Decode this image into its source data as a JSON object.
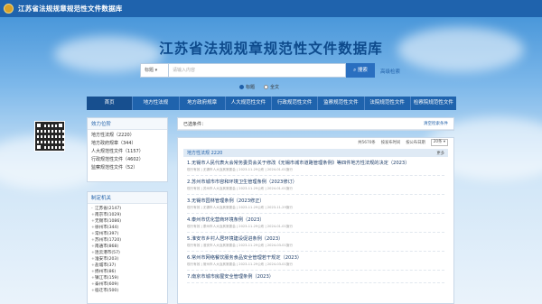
{
  "header": {
    "site_title": "江苏省法规规章规范性文件数据库",
    "links": [
      "",
      ""
    ]
  },
  "main_title": "江苏省法规规章规范性文件数据库",
  "search": {
    "scope_value": "标题",
    "placeholder": "请输入内容",
    "button_label": "搜索",
    "advanced_label": "高级检索",
    "radio_options": [
      "标题",
      "全文"
    ],
    "radio_selected": 0
  },
  "nav": {
    "tabs": [
      "首页",
      "地方性法规",
      "地方政府规章",
      "人大规范性文件",
      "行政规范性文件",
      "监察规范性文件",
      "法院规范性文件",
      "检察院规范性文件"
    ],
    "active_index": 0
  },
  "left": {
    "qr_caption": "",
    "scope_panel": {
      "title": "效力位阶",
      "items": [
        "地方性法规（2220）",
        "地方政府规章（344）",
        "人大规范性文件（1157）",
        "行政规范性文件（4602）",
        "监察规范性文件（52）"
      ]
    },
    "org_panel": {
      "title": "制定机关",
      "items": [
        "江苏省(2147)",
        "南京市(1029)",
        "无锡市(1086)",
        "徐州市(344)",
        "常州市(397)",
        "苏州市(1720)",
        "南通市(868)",
        "连云港市(57)",
        "淮安市(203)",
        "盐城市(37)",
        "扬州市(86)",
        "镇江市(159)",
        "泰州市(609)",
        "宿迁市(500)"
      ]
    }
  },
  "results": {
    "filter_label": "已选条件：",
    "clear_label": "清空检索条件",
    "count_text": "共5670条",
    "sort_labels": [
      "按发布时间",
      "按公布日期"
    ],
    "page_size": "20条",
    "category": {
      "title": "地方性法规 2220",
      "more": "更多"
    },
    "items": [
      {
        "title": "1.无锡市人民代表大会常务委员会关于修改《无锡市城市道路管理条例》等四件地方性法规的决定（2023）",
        "meta": "现行有效 | 无锡市人大及其常委会 | 2023-11-29公布 | 2024-01-01施行"
      },
      {
        "title": "2.苏州市城市市容和环境卫生管理条例（2023修订）",
        "meta": "现行有效 | 苏州市人大及其常委会 | 2023-11-29公布 | 2024-01-01施行"
      },
      {
        "title": "3.无锡市园林管理条例（2023修正）",
        "meta": "现行有效 | 无锡市人大及其常委会 | 2023-11-29公布 | 2023-11-29施行"
      },
      {
        "title": "4.泰州市优化营商环境条例（2023）",
        "meta": "现行有效 | 泰州市人大及其常委会 | 2023-11-29公布 | 2024-01-01施行"
      },
      {
        "title": "5.淮安市乡村人居环境建设促进条例（2023）",
        "meta": "现行有效 | 淮安市人大及其常委会 | 2023-11-29公布 | 2024-03-01施行"
      },
      {
        "title": "6.常州市网络餐饮服务食品安全管理若干规定（2023）",
        "meta": "现行有效 | 常州市人大及其常委会 | 2023-11-29公布 | 2024-03-01施行"
      },
      {
        "title": "7.南京市城市房屋安全管理条例（2023）",
        "meta": ""
      }
    ]
  },
  "colors": {
    "nav": "#1f63ad",
    "title": "#0d4a8c",
    "link": "#1f5fa8"
  }
}
